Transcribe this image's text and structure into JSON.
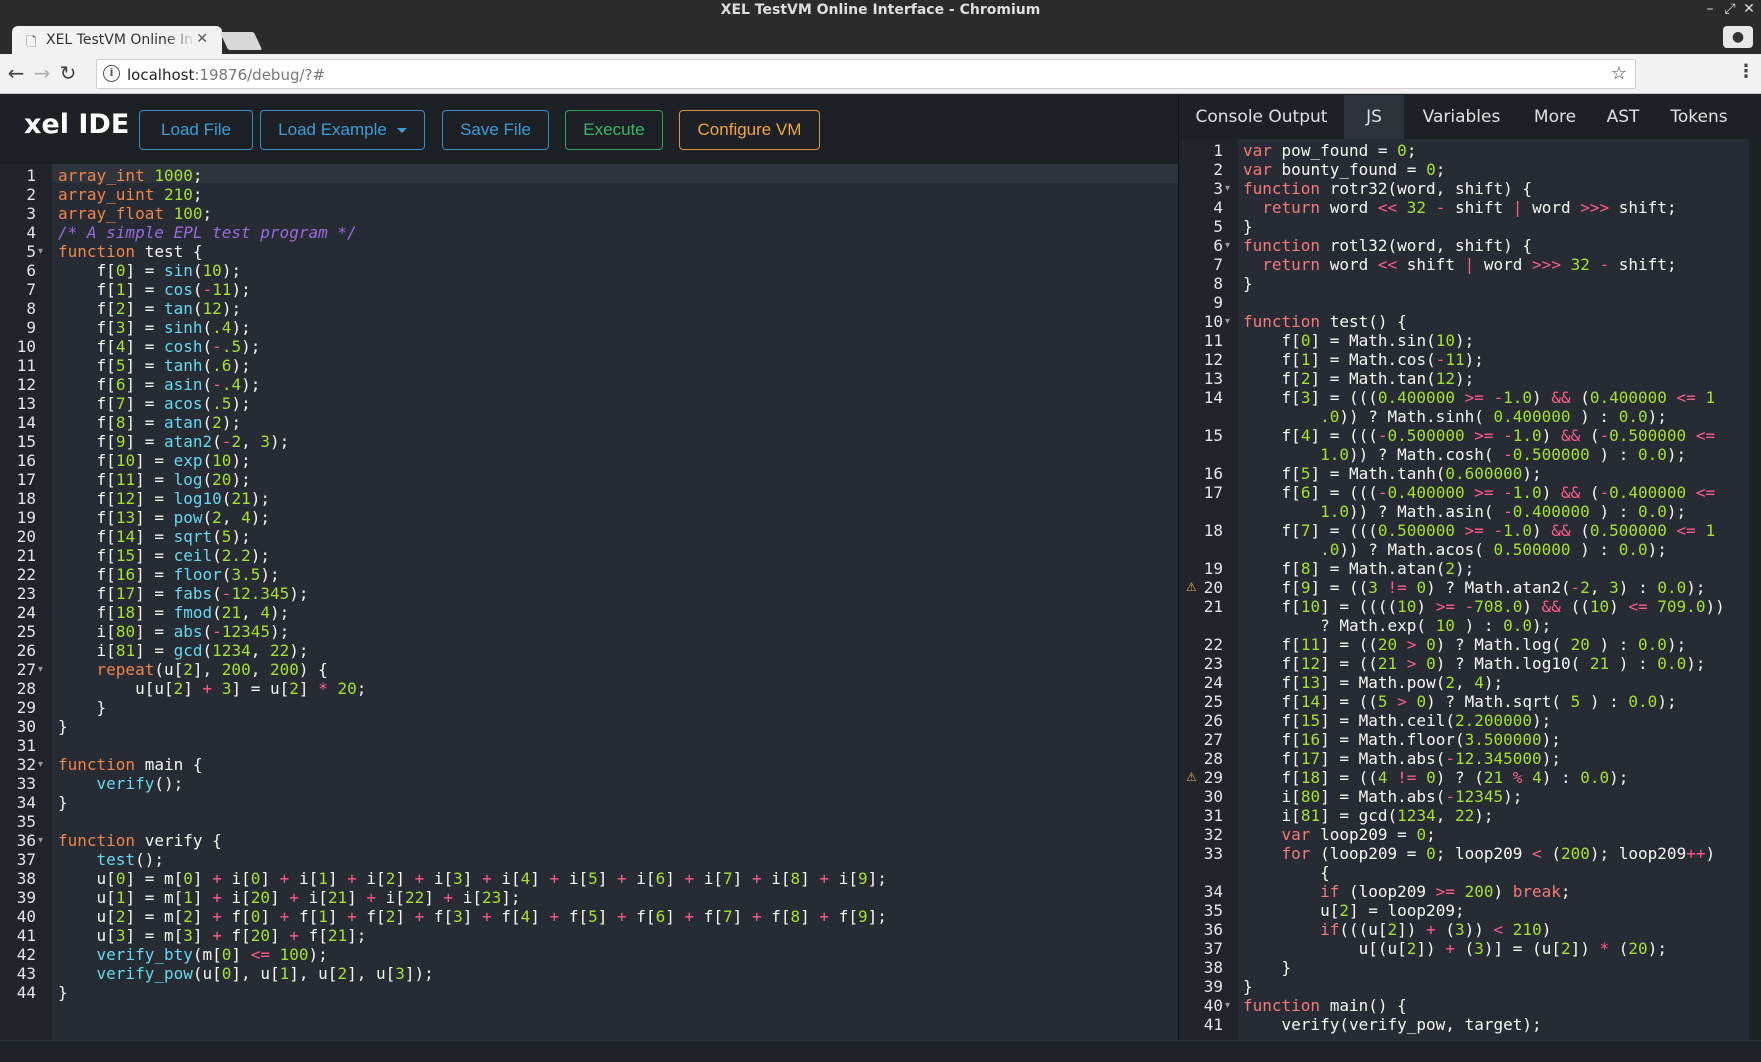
{
  "window": {
    "title": "XEL TestVM Online Interface - Chromium"
  },
  "browser": {
    "tab_label": "XEL TestVM Online Interface",
    "url_host": "localhost",
    "url_rest": ":19876/debug/?#"
  },
  "ide": {
    "brand": "xel IDE",
    "buttons": {
      "load_file": "Load File",
      "load_example": "Load Example",
      "save_file": "Save File",
      "execute": "Execute",
      "configure_vm": "Configure VM"
    }
  },
  "output_tabs": {
    "console_output": "Console Output",
    "js": "JS",
    "variables": "Variables",
    "more": "More",
    "ast": "AST",
    "tokens": "Tokens"
  },
  "colors": {
    "keyword": "#f0864a",
    "function_call": "#66d9ef",
    "number": "#a6e22e",
    "operator": "#ff5c8a",
    "comment": "#9b6be0",
    "warning": "#e8b04a"
  },
  "source_editor": {
    "lines": [
      "array_int 1000;",
      "array_uint 210;",
      "array_float 100;",
      "/* A simple EPL test program */",
      "function test {",
      "    f[0] = sin(10);",
      "    f[1] = cos(-11);",
      "    f[2] = tan(12);",
      "    f[3] = sinh(.4);",
      "    f[4] = cosh(-.5);",
      "    f[5] = tanh(.6);",
      "    f[6] = asin(-.4);",
      "    f[7] = acos(.5);",
      "    f[8] = atan(2);",
      "    f[9] = atan2(-2, 3);",
      "    f[10] = exp(10);",
      "    f[11] = log(20);",
      "    f[12] = log10(21);",
      "    f[13] = pow(2, 4);",
      "    f[14] = sqrt(5);",
      "    f[15] = ceil(2.2);",
      "    f[16] = floor(3.5);",
      "    f[17] = fabs(-12.345);",
      "    f[18] = fmod(21, 4);",
      "    i[80] = abs(-12345);",
      "    i[81] = gcd(1234, 22);",
      "    repeat(u[2], 200, 200) {",
      "        u[u[2] + 3] = u[2] * 20;",
      "    }",
      "}",
      "",
      "function main {",
      "    verify();",
      "}",
      "",
      "function verify {",
      "    test();",
      "    u[0] = m[0] + i[0] + i[1] + i[2] + i[3] + i[4] + i[5] + i[6] + i[7] + i[8] + i[9];",
      "    u[1] = m[1] + i[20] + i[21] + i[22] + i[23];",
      "    u[2] = m[2] + f[0] + f[1] + f[2] + f[3] + f[4] + f[5] + f[6] + f[7] + f[8] + f[9];",
      "    u[3] = m[3] + f[20] + f[21];",
      "    verify_bty(m[0] <= 100);",
      "    verify_pow(u[0], u[1], u[2], u[3]);",
      "}"
    ]
  },
  "js_editor": {
    "rows": [
      {
        "n": "1",
        "t": "var pow_found = 0;"
      },
      {
        "n": "2",
        "t": "var bounty_found = 0;"
      },
      {
        "n": "3",
        "t": "function rotr32(word, shift) {"
      },
      {
        "n": "4",
        "t": "  return word << 32 - shift | word >>> shift;"
      },
      {
        "n": "5",
        "t": "}"
      },
      {
        "n": "6",
        "t": "function rotl32(word, shift) {"
      },
      {
        "n": "7",
        "t": "  return word << shift | word >>> 32 - shift;"
      },
      {
        "n": "8",
        "t": "}"
      },
      {
        "n": "9",
        "t": ""
      },
      {
        "n": "10",
        "t": "function test() {"
      },
      {
        "n": "11",
        "t": "    f[0] = Math.sin(10);"
      },
      {
        "n": "12",
        "t": "    f[1] = Math.cos(-11);"
      },
      {
        "n": "13",
        "t": "    f[2] = Math.tan(12);"
      },
      {
        "n": "14",
        "t": "    f[3] = (((0.400000 >= -1.0) && (0.400000 <= 1"
      },
      {
        "n": "",
        "t": "        .0)) ? Math.sinh( 0.400000 ) : 0.0);"
      },
      {
        "n": "15",
        "t": "    f[4] = (((-0.500000 >= -1.0) && (-0.500000 <="
      },
      {
        "n": "",
        "t": "        1.0)) ? Math.cosh( -0.500000 ) : 0.0);"
      },
      {
        "n": "16",
        "t": "    f[5] = Math.tanh(0.600000);"
      },
      {
        "n": "17",
        "t": "    f[6] = (((-0.400000 >= -1.0) && (-0.400000 <="
      },
      {
        "n": "",
        "t": "        1.0)) ? Math.asin( -0.400000 ) : 0.0);"
      },
      {
        "n": "18",
        "t": "    f[7] = (((0.500000 >= -1.0) && (0.500000 <= 1"
      },
      {
        "n": "",
        "t": "        .0)) ? Math.acos( 0.500000 ) : 0.0);"
      },
      {
        "n": "19",
        "t": "    f[8] = Math.atan(2);"
      },
      {
        "n": "20",
        "t": "    f[9] = ((3 != 0) ? Math.atan2(-2, 3) : 0.0);",
        "warn": true
      },
      {
        "n": "21",
        "t": "    f[10] = ((((10) >= -708.0) && ((10) <= 709.0))"
      },
      {
        "n": "",
        "t": "        ? Math.exp( 10 ) : 0.0);"
      },
      {
        "n": "22",
        "t": "    f[11] = ((20 > 0) ? Math.log( 20 ) : 0.0);"
      },
      {
        "n": "23",
        "t": "    f[12] = ((21 > 0) ? Math.log10( 21 ) : 0.0);"
      },
      {
        "n": "24",
        "t": "    f[13] = Math.pow(2, 4);"
      },
      {
        "n": "25",
        "t": "    f[14] = ((5 > 0) ? Math.sqrt( 5 ) : 0.0);"
      },
      {
        "n": "26",
        "t": "    f[15] = Math.ceil(2.200000);"
      },
      {
        "n": "27",
        "t": "    f[16] = Math.floor(3.500000);"
      },
      {
        "n": "28",
        "t": "    f[17] = Math.abs(-12.345000);"
      },
      {
        "n": "29",
        "t": "    f[18] = ((4 != 0) ? (21 % 4) : 0.0);",
        "warn": true
      },
      {
        "n": "30",
        "t": "    i[80] = Math.abs(-12345);"
      },
      {
        "n": "31",
        "t": "    i[81] = gcd(1234, 22);"
      },
      {
        "n": "32",
        "t": "    var loop209 = 0;"
      },
      {
        "n": "33",
        "t": "    for (loop209 = 0; loop209 < (200); loop209++)"
      },
      {
        "n": "",
        "t": "        {"
      },
      {
        "n": "34",
        "t": "        if (loop209 >= 200) break;"
      },
      {
        "n": "35",
        "t": "        u[2] = loop209;"
      },
      {
        "n": "36",
        "t": "        if(((u[2]) + (3)) < 210)"
      },
      {
        "n": "37",
        "t": "            u[(u[2]) + (3)] = (u[2]) * (20);"
      },
      {
        "n": "38",
        "t": "    }"
      },
      {
        "n": "39",
        "t": "}"
      },
      {
        "n": "40",
        "t": "function main() {"
      },
      {
        "n": "41",
        "t": "    verify(verify_pow, target);"
      }
    ]
  }
}
